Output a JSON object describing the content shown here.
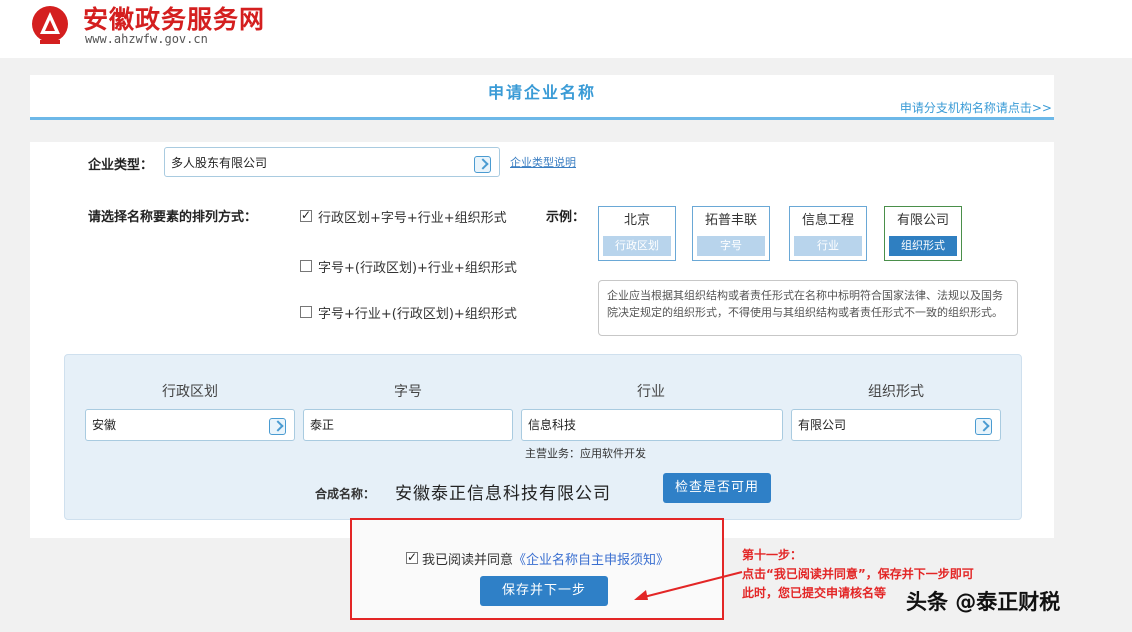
{
  "header": {
    "site_name": "安徽政务服务网",
    "site_url": "www.ahzwfw.gov.cn",
    "brand_color": "#d41f1f"
  },
  "title_panel": {
    "title": "申请企业名称",
    "branch_link": "申请分支机构名称请点击>>"
  },
  "form": {
    "company_type_label": "企业类型：",
    "company_type_value": "多人股东有限公司",
    "company_type_help": "企业类型说明",
    "order_label": "请选择名称要素的排列方式：",
    "order_options": [
      {
        "label": "行政区划+字号+行业+组织形式",
        "checked": true
      },
      {
        "label": "字号+(行政区划)+行业+组织形式",
        "checked": false
      },
      {
        "label": "字号+行业+(行政区划)+组织形式",
        "checked": false
      }
    ],
    "example_label": "示例：",
    "examples": [
      {
        "word": "北京",
        "part": "行政区划",
        "active": false
      },
      {
        "word": "拓普丰联",
        "part": "字号",
        "active": false
      },
      {
        "word": "信息工程",
        "part": "行业",
        "active": false
      },
      {
        "word": "有限公司",
        "part": "组织形式",
        "active": true
      }
    ],
    "example_note": "企业应当根据其组织结构或者责任形式在名称中标明符合国家法律、法规以及国务院决定规定的组织形式，不得使用与其组织结构或者责任形式不一致的组织形式。"
  },
  "compose": {
    "headers": [
      "行政区划",
      "字号",
      "行业",
      "组织形式"
    ],
    "values": [
      "安徽",
      "泰正",
      "信息科技",
      "有限公司"
    ],
    "industry_note": "主营业务：应用软件开发",
    "combined_label": "合成名称：",
    "combined_name": "安徽泰正信息科技有限公司",
    "check_button": "检查是否可用"
  },
  "agree": {
    "prefix": "我已阅读并同意",
    "link_text": "《企业名称自主申报须知》",
    "checked": true,
    "save_button": "保存并下一步"
  },
  "annotation": {
    "step": "第十一步：",
    "line1": "点击“我已阅读并同意”，保存并下一步即可",
    "line2": "此时，您已提交申请核名等",
    "color": "#e32626"
  },
  "watermark": "头条 @泰正财税",
  "colors": {
    "accent": "#2f80c7",
    "title_blue": "#3a9bd6",
    "panel_bg": "#e6f0f8"
  }
}
